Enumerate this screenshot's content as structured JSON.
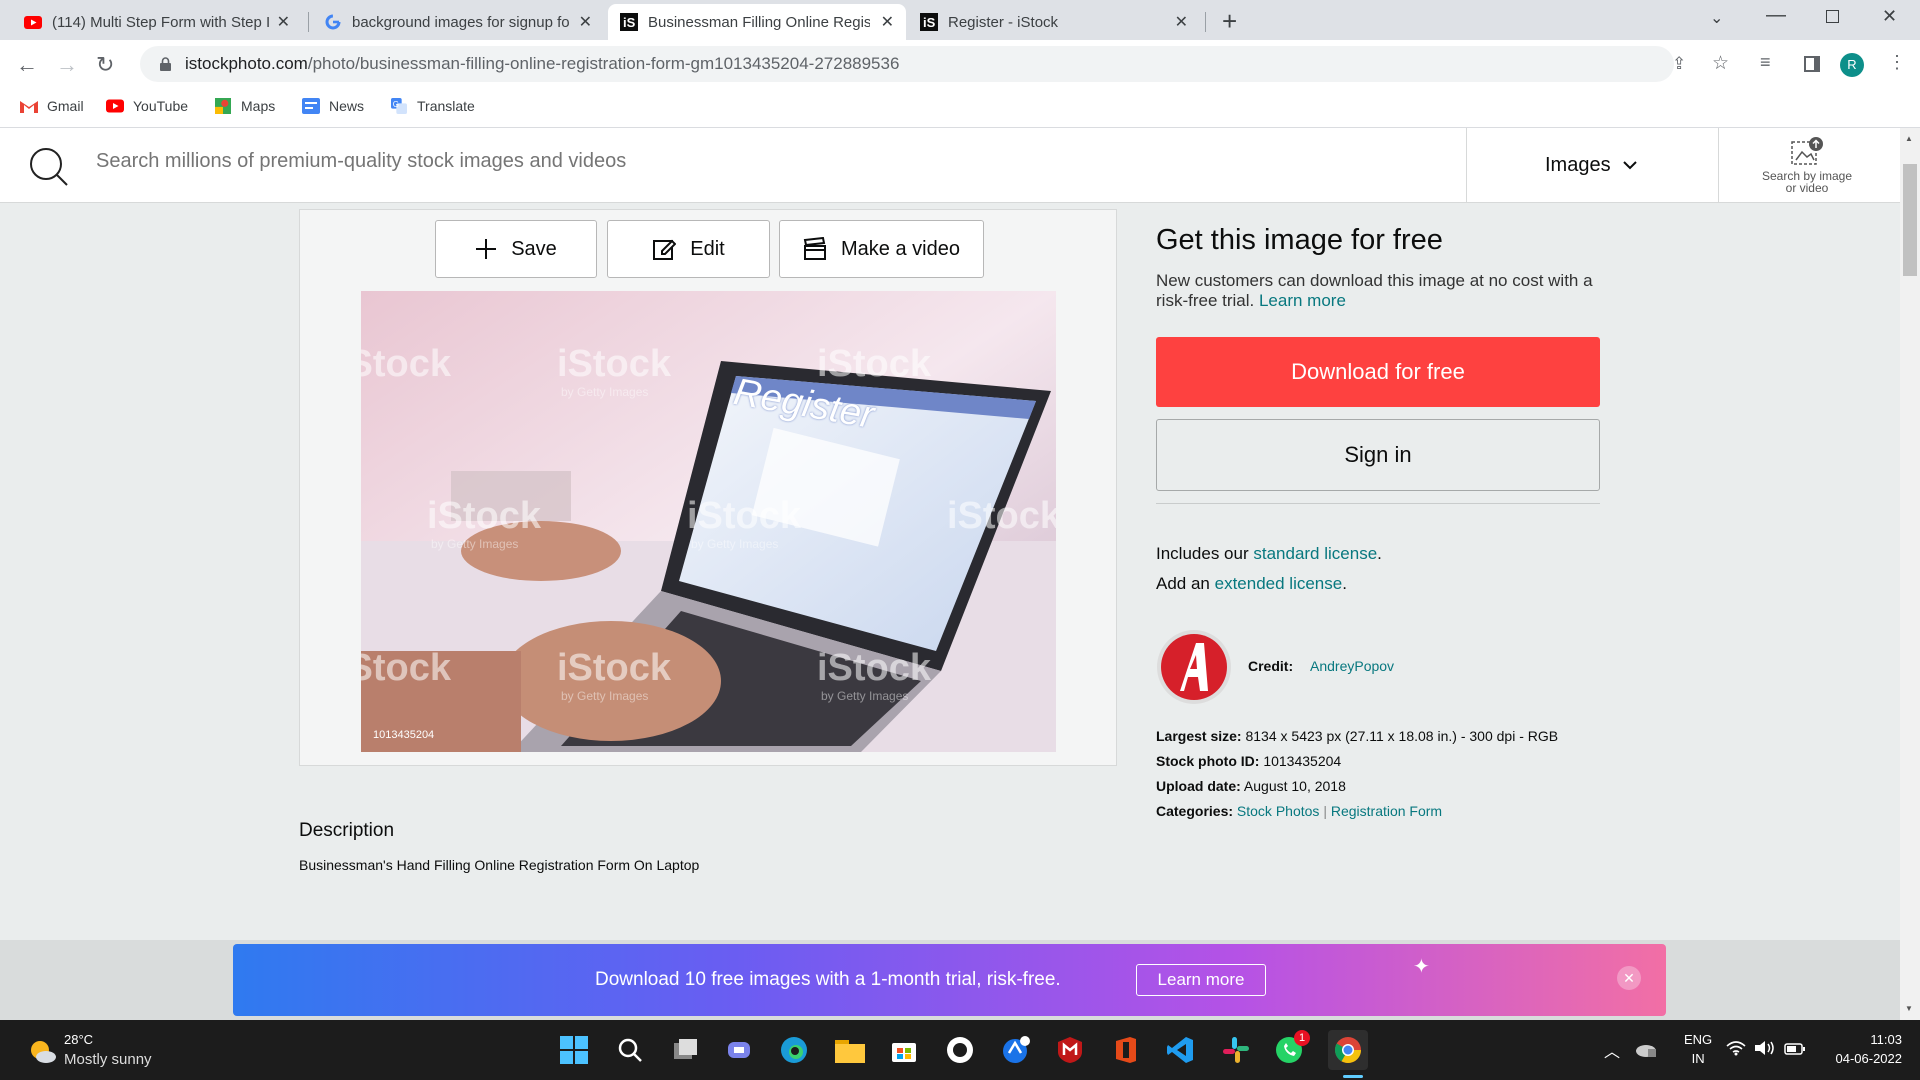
{
  "tabs": [
    {
      "title": "(114) Multi Step Form with Step I",
      "favicon": "youtube-icon"
    },
    {
      "title": "background images for signup fo",
      "favicon": "google-icon"
    },
    {
      "title": "Businessman Filling Online Regis",
      "favicon": "istock-icon"
    },
    {
      "title": "Register - iStock",
      "favicon": "istock-icon"
    }
  ],
  "address": {
    "host": "istockphoto.com",
    "path": "/photo/businessman-filling-online-registration-form-gm1013435204-272889536"
  },
  "profile_initial": "R",
  "bookmarks": [
    "Gmail",
    "YouTube",
    "Maps",
    "News",
    "Translate"
  ],
  "search": {
    "placeholder": "Search millions of premium-quality stock images and videos",
    "type": "Images",
    "by_image": "Search by image or video"
  },
  "actions": {
    "save": "Save",
    "edit": "Edit",
    "video": "Make a video"
  },
  "photo": {
    "id_label": "1013435204",
    "screen_text": "Register",
    "watermark": "iStock",
    "watermark_sub": "by Getty Images"
  },
  "offer": {
    "heading": "Get this image for free",
    "body": "New customers can download this image at no cost with a risk-free trial.",
    "learn_more": "Learn more",
    "download": "Download for free",
    "sign_in": "Sign in"
  },
  "license": {
    "line1_prefix": "Includes our",
    "line1_link": "standard license",
    "line1_suffix": ".",
    "line2_prefix": "Add an",
    "line2_link": "extended license",
    "line2_suffix": "."
  },
  "credit": {
    "label": "Credit:",
    "name": "AndreyPopov"
  },
  "details": {
    "size_label": "Largest size:",
    "size_value": "8134 x 5423 px (27.11 x 18.08 in.) - 300 dpi - RGB",
    "id_label": "Stock photo ID:",
    "id_value": "1013435204",
    "date_label": "Upload date:",
    "date_value": "August 10, 2018",
    "cat_label": "Categories:",
    "cat1": "Stock Photos",
    "cat_sep": "|",
    "cat2": "Registration Form"
  },
  "description": {
    "heading": "Description",
    "text": "Businessman's Hand Filling Online Registration Form On Laptop"
  },
  "banner": {
    "text": "Download 10 free images with a 1-month trial, risk-free.",
    "button": "Learn more"
  },
  "taskbar": {
    "temp": "28°C",
    "weather": "Mostly sunny",
    "lang1": "ENG",
    "lang2": "IN",
    "time": "11:03",
    "date": "04-06-2022",
    "whatsapp_badge": "1"
  },
  "colors": {
    "accent": "#08787f",
    "download": "#fe4140",
    "banner_start": "#2f7af0",
    "banner_end": "#f26fa5"
  }
}
